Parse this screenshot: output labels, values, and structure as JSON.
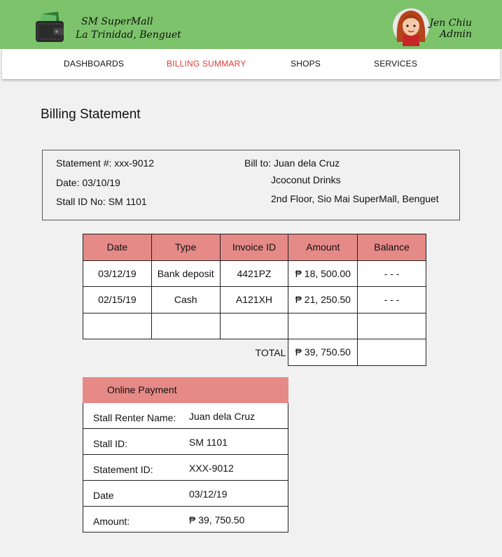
{
  "header": {
    "mall_name": "SM SuperMall",
    "mall_location": "La Trinidad, Benguet",
    "user_name": "Jen Chiu",
    "user_role": "Admin",
    "logo_icon": "wallet-icon",
    "avatar_icon": "user-avatar"
  },
  "nav": {
    "items": [
      {
        "label": "DASHBOARDS"
      },
      {
        "label": "BILLING SUMMARY"
      },
      {
        "label": "SHOPS"
      },
      {
        "label": "SERVICES"
      }
    ],
    "active_color": "#e53935"
  },
  "page": {
    "title": "Billing Statement"
  },
  "statement": {
    "number": "Statement #: xxx-9012",
    "date": "Date: 03/10/19",
    "stall_id": "Stall ID No: SM 1101",
    "bill_to": "Bill to: Juan dela Cruz",
    "business": "Jcoconut Drinks",
    "address": "2nd Floor, Sio Mai SuperMall, Benguet"
  },
  "billing_table": {
    "headers": [
      "Date",
      "Type",
      "Invoice ID",
      "Amount",
      "Balance"
    ],
    "rows": [
      [
        "03/12/19",
        "Bank deposit",
        "4421PZ",
        "₱ 18, 500.00",
        "- - -"
      ],
      [
        "02/15/19",
        "Cash",
        "A121XH",
        "₱ 21, 250.50",
        "- - -"
      ]
    ],
    "total_label": "TOTAL",
    "total_value": "₱ 39, 750.50",
    "header_color": "#e68a87"
  },
  "online_payment": {
    "title": "Online Payment",
    "fields": [
      {
        "label": "Stall Renter Name:",
        "value": "Juan dela Cruz"
      },
      {
        "label": "Stall ID:",
        "value": "SM 1101"
      },
      {
        "label": "Statement ID:",
        "value": "XXX-9012"
      },
      {
        "label": "Date",
        "value": "03/12/19"
      },
      {
        "label": "Amount:",
        "value": "₱ 39, 750.50"
      }
    ]
  },
  "colors": {
    "header_bg": "#7dc36b",
    "table_header": "#e68a87"
  }
}
